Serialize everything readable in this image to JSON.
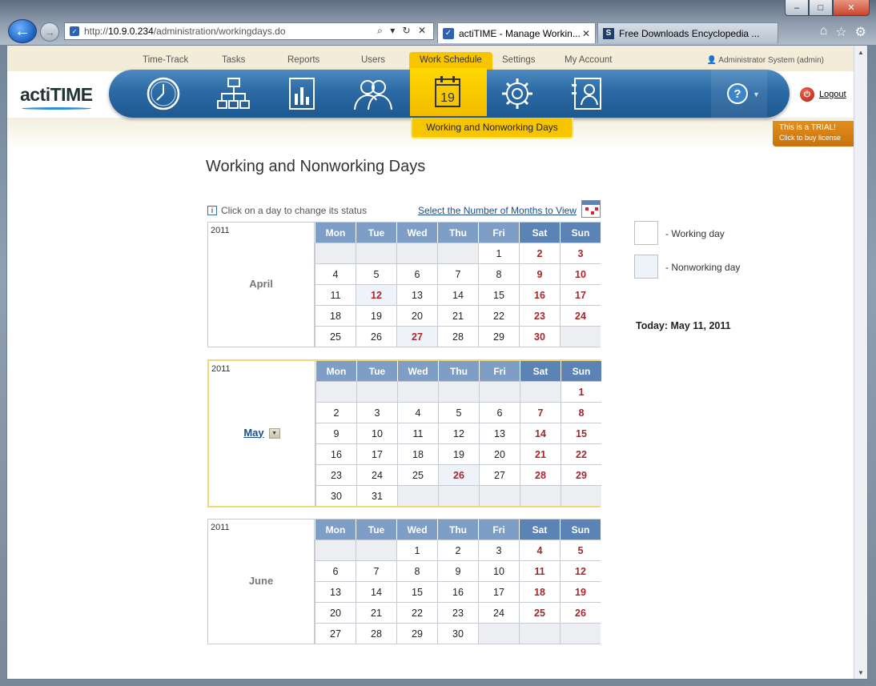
{
  "browser": {
    "url_prefix": "http://",
    "url_host": "10.9.0.234",
    "url_path": "/administration/workingdays.do",
    "address_tools": "⌕ ▾ ↻ ✕",
    "active_tab": "actiTIME - Manage Workin...",
    "other_tab": "Free Downloads Encyclopedia ...",
    "other_tab_icon": "S",
    "window_buttons": [
      "–",
      "□",
      "✕"
    ]
  },
  "menu": {
    "items": [
      "Time-Track",
      "Tasks",
      "Reports",
      "Users",
      "Work Schedule",
      "Settings",
      "My Account"
    ],
    "active": "Work Schedule",
    "user": "Administrator System (admin)"
  },
  "logo": "actiTIME",
  "subtab": "Working and Nonworking Days",
  "logout": "Logout",
  "trial": {
    "line1": "This is a TRIAL!",
    "line2": "Click to buy license"
  },
  "help_icon": "?",
  "page_title": "Working and Nonworking Days",
  "hint": "Click on a day to change its status",
  "months_link": "Select the Number of Months to View",
  "weekdays": [
    "Mon",
    "Tue",
    "Wed",
    "Thu",
    "Fri",
    "Sat",
    "Sun"
  ],
  "months": [
    {
      "year": "2011",
      "name": "April",
      "current": false,
      "weeks": [
        [
          "",
          "",
          "",
          "",
          "1",
          "2",
          "3"
        ],
        [
          "4",
          "5",
          "6",
          "7",
          "8",
          "9",
          "10"
        ],
        [
          "11",
          "12",
          "13",
          "14",
          "15",
          "16",
          "17"
        ],
        [
          "18",
          "19",
          "20",
          "21",
          "22",
          "23",
          "24"
        ],
        [
          "25",
          "26",
          "27",
          "28",
          "29",
          "30",
          ""
        ]
      ],
      "nonworking": [
        "2",
        "3",
        "9",
        "10",
        "12",
        "16",
        "17",
        "23",
        "24",
        "27",
        "30"
      ]
    },
    {
      "year": "2011",
      "name": "May",
      "current": true,
      "weeks": [
        [
          "",
          "",
          "",
          "",
          "",
          "",
          "1"
        ],
        [
          "2",
          "3",
          "4",
          "5",
          "6",
          "7",
          "8"
        ],
        [
          "9",
          "10",
          "11",
          "12",
          "13",
          "14",
          "15"
        ],
        [
          "16",
          "17",
          "18",
          "19",
          "20",
          "21",
          "22"
        ],
        [
          "23",
          "24",
          "25",
          "26",
          "27",
          "28",
          "29"
        ],
        [
          "30",
          "31",
          "",
          "",
          "",
          "",
          ""
        ]
      ],
      "nonworking": [
        "1",
        "7",
        "8",
        "14",
        "15",
        "21",
        "22",
        "26",
        "28",
        "29"
      ]
    },
    {
      "year": "2011",
      "name": "June",
      "current": false,
      "weeks": [
        [
          "",
          "",
          "1",
          "2",
          "3",
          "4",
          "5"
        ],
        [
          "6",
          "7",
          "8",
          "9",
          "10",
          "11",
          "12"
        ],
        [
          "13",
          "14",
          "15",
          "16",
          "17",
          "18",
          "19"
        ],
        [
          "20",
          "21",
          "22",
          "23",
          "24",
          "25",
          "26"
        ],
        [
          "27",
          "28",
          "29",
          "30",
          "",
          "",
          ""
        ]
      ],
      "nonworking": [
        "4",
        "5",
        "11",
        "12",
        "18",
        "19",
        "25",
        "26"
      ]
    }
  ],
  "legend": {
    "working": "- Working day",
    "nonworking": "- Nonworking day"
  },
  "today": "Today: May 11, 2011",
  "colors": {
    "nav_blue": "#2b6aa5",
    "work_schedule_yellow": "#f7c500",
    "weekend_red": "#a8262b",
    "header_blue": "#7f9ec6",
    "header_weekend_blue": "#5b83b5"
  }
}
